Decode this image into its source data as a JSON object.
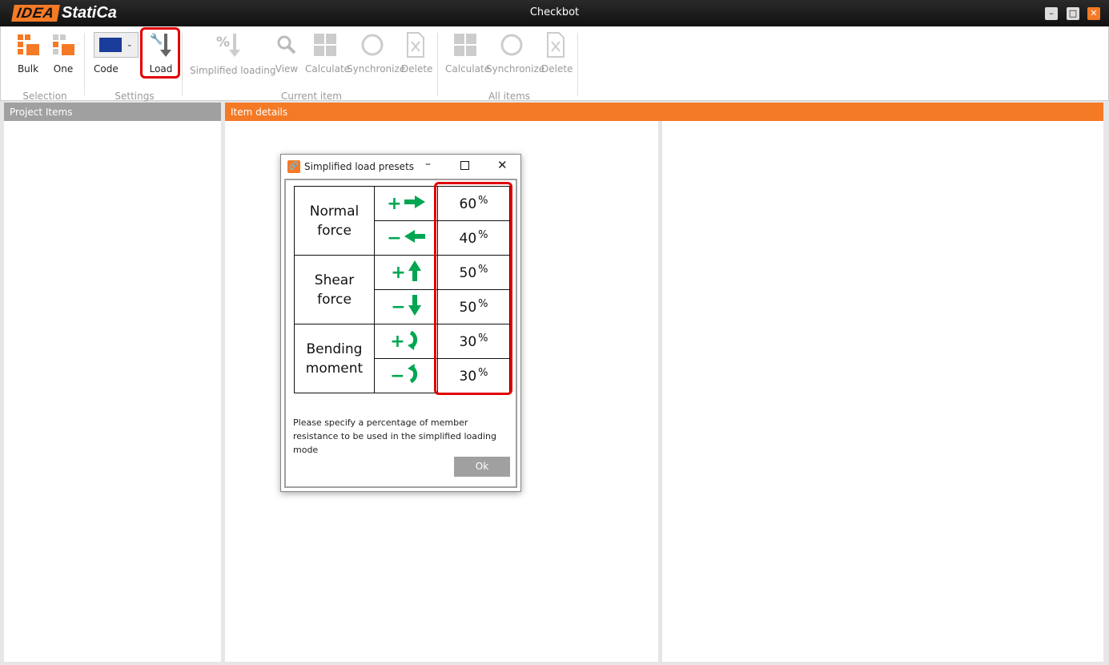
{
  "app": {
    "logo": "IDEA StatiCa",
    "title": "Checkbot"
  },
  "ribbon": {
    "selection": {
      "label": "Selection",
      "bulk": "Bulk",
      "one": "One"
    },
    "settings": {
      "label": "Settings",
      "code": "Code",
      "load": "Load"
    },
    "current_item": {
      "label": "Current item",
      "simplified_loading": "Simplified loading",
      "view": "View",
      "calculate": "Calculate",
      "synchronize": "Synchronize",
      "delete": "Delete"
    },
    "all_items": {
      "label": "All items",
      "calculate": "Calculate",
      "synchronize": "Synchronize",
      "delete": "Delete"
    }
  },
  "panels": {
    "project_items": "Project Items",
    "item_details": "Item details"
  },
  "colors": {
    "accent": "#f47a26",
    "highlight": "#e00000",
    "arrow": "#00a651"
  },
  "dialog": {
    "title": "Simplified load presets",
    "rows": [
      {
        "name_line1": "Normal",
        "name_line2": "force",
        "items": [
          {
            "sign": "+",
            "icon": "arrow-right-icon",
            "value": "60"
          },
          {
            "sign": "−",
            "icon": "arrow-left-icon",
            "value": "40"
          }
        ]
      },
      {
        "name_line1": "Shear",
        "name_line2": "force",
        "items": [
          {
            "sign": "+",
            "icon": "arrow-up-icon",
            "value": "50"
          },
          {
            "sign": "−",
            "icon": "arrow-down-icon",
            "value": "50"
          }
        ]
      },
      {
        "name_line1": "Bending",
        "name_line2": "moment",
        "items": [
          {
            "sign": "+",
            "icon": "rotate-clockwise-icon",
            "value": "30"
          },
          {
            "sign": "−",
            "icon": "rotate-counterclockwise-icon",
            "value": "30"
          }
        ]
      }
    ],
    "unit": "%",
    "note": "Please specify a percentage of member resistance to be used in the simplified loading mode",
    "ok": "Ok"
  }
}
